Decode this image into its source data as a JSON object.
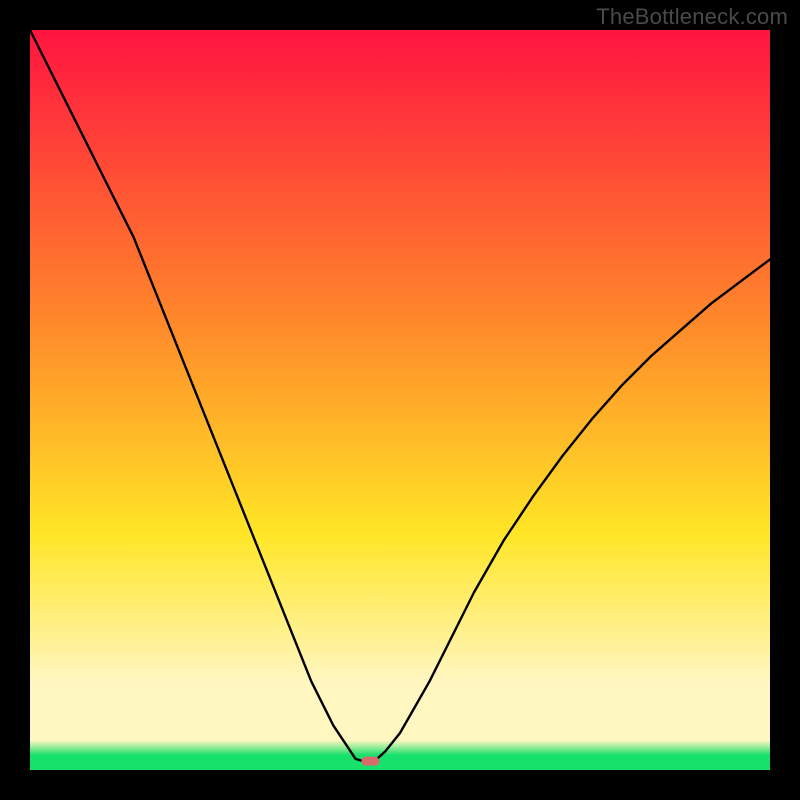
{
  "watermark": "TheBottleneck.com",
  "colors": {
    "frame": "#000000",
    "curve": "#000000",
    "marker": "#d86a6c",
    "gradient_top": "#ff1440",
    "gradient_mid1": "#ff8a2a",
    "gradient_mid2": "#ffe626",
    "gradient_band": "#fff6c0",
    "gradient_green": "#17e06b"
  },
  "chart_data": {
    "type": "line",
    "title": "",
    "xlabel": "",
    "ylabel": "",
    "xlim": [
      0,
      100
    ],
    "ylim": [
      0,
      100
    ],
    "legend": false,
    "grid": false,
    "minimum_x": 44,
    "marker": {
      "x": 46,
      "y": 1.2
    },
    "series": [
      {
        "name": "bottleneck-curve",
        "x": [
          0,
          2,
          4,
          6,
          8,
          10,
          12,
          14,
          16,
          18,
          20,
          22,
          24,
          26,
          28,
          30,
          32,
          34,
          36,
          38,
          40,
          41,
          42,
          43,
          44,
          45,
          46,
          47,
          48,
          50,
          52,
          54,
          56,
          58,
          60,
          64,
          68,
          72,
          76,
          80,
          84,
          88,
          92,
          96,
          100
        ],
        "y": [
          100,
          96,
          92,
          88,
          84,
          80,
          76,
          72,
          67,
          62,
          57,
          52,
          47,
          42,
          37,
          32,
          27,
          22,
          17,
          12,
          8,
          6,
          4.5,
          3,
          1.5,
          1.2,
          1.2,
          1.6,
          2.5,
          5,
          8.5,
          12,
          16,
          20,
          24,
          31,
          37,
          42.5,
          47.5,
          52,
          56,
          59.5,
          63,
          66,
          69
        ]
      }
    ]
  }
}
